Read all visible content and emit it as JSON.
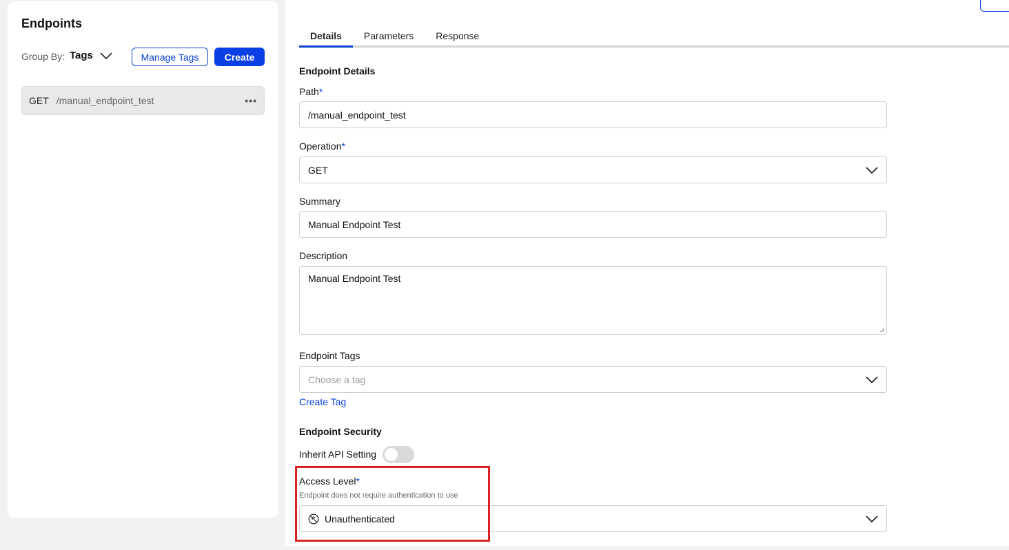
{
  "sidebar": {
    "title": "Endpoints",
    "group_by_label": "Group By:",
    "group_by_value": "Tags",
    "manage_tags_label": "Manage Tags",
    "create_label": "Create",
    "endpoints": [
      {
        "method": "GET",
        "path": "/manual_endpoint_test",
        "more": "•••"
      }
    ]
  },
  "tabs": [
    {
      "label": "Details",
      "active": true
    },
    {
      "label": "Parameters",
      "active": false
    },
    {
      "label": "Response",
      "active": false
    }
  ],
  "details": {
    "section_title": "Endpoint Details",
    "path": {
      "label": "Path",
      "required_mark": "*",
      "value": "/manual_endpoint_test"
    },
    "operation": {
      "label": "Operation",
      "required_mark": "*",
      "value": "GET"
    },
    "summary": {
      "label": "Summary",
      "value": "Manual Endpoint Test"
    },
    "description": {
      "label": "Description",
      "value": "Manual Endpoint Test"
    },
    "tags": {
      "label": "Endpoint Tags",
      "placeholder": "Choose a tag",
      "create_link": "Create Tag"
    }
  },
  "security": {
    "section_title": "Endpoint Security",
    "inherit_label": "Inherit API Setting",
    "inherit_enabled": false,
    "access_level": {
      "label": "Access Level",
      "required_mark": "*",
      "hint": "Endpoint does not require authentication to use",
      "value": "Unauthenticated",
      "icon": "no-auth-icon"
    }
  },
  "colors": {
    "accent": "#0a3fd6",
    "highlight": "#d92323"
  }
}
